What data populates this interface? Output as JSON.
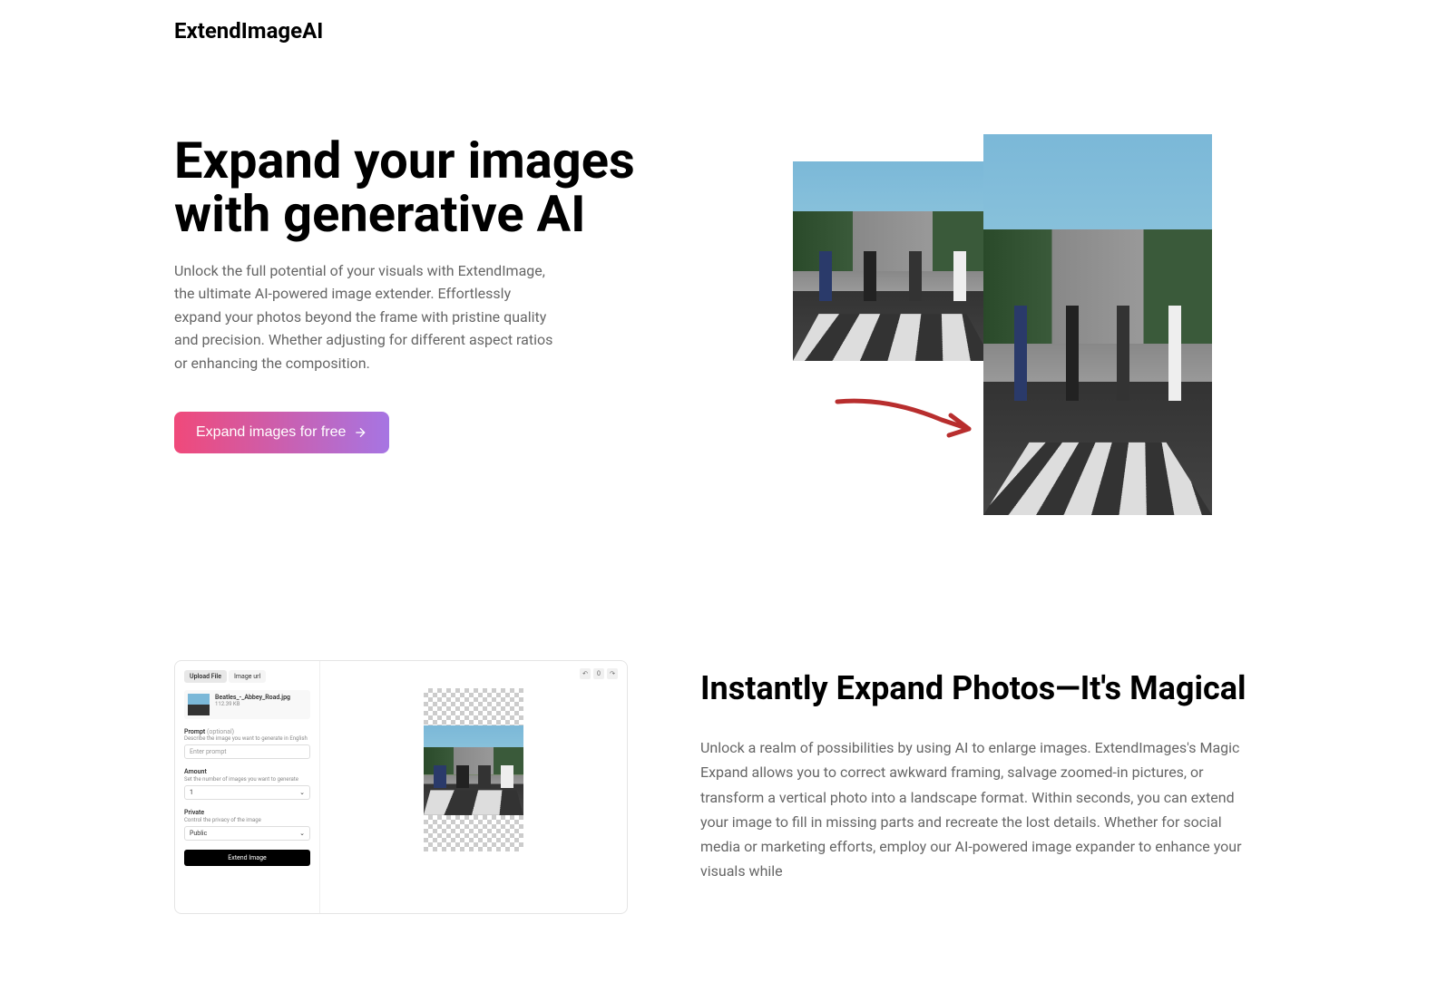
{
  "brand": "ExtendImageAI",
  "hero": {
    "title": "Expand your images with generative AI",
    "description": "Unlock the full potential of your visuals with ExtendImage, the ultimate AI-powered image extender. Effortlessly expand your photos beyond the frame with pristine quality and precision. Whether adjusting for different aspect ratios or enhancing the composition.",
    "cta": "Expand images for free"
  },
  "section2": {
    "title": "Instantly Expand Photos—It's Magical",
    "description": "Unlock a realm of possibilities by using AI to enlarge images. ExtendImages's Magic Expand allows you to correct awkward framing, salvage zoomed-in pictures, or transform a vertical photo into a landscape format. Within seconds, you can extend your image to fill in missing parts and recreate the lost details. Whether for social media or marketing efforts, employ our AI-powered image expander to enhance your visuals while"
  },
  "uimock": {
    "tabs": {
      "upload": "Upload File",
      "url": "Image url"
    },
    "file": {
      "name": "Beatles_-_Abbey_Road.jpg",
      "size": "112.39 KB"
    },
    "prompt": {
      "label": "Prompt",
      "optional": "(optional)",
      "hint": "Describe the image you want to generate in English",
      "placeholder": "Enter prompt"
    },
    "amount": {
      "label": "Amount",
      "hint": "Set the number of images you want to generate",
      "value": "1"
    },
    "private": {
      "label": "Private",
      "hint": "Control the privacy of the image",
      "value": "Public"
    },
    "submit": "Extend Image",
    "actions": {
      "count": "0"
    }
  }
}
